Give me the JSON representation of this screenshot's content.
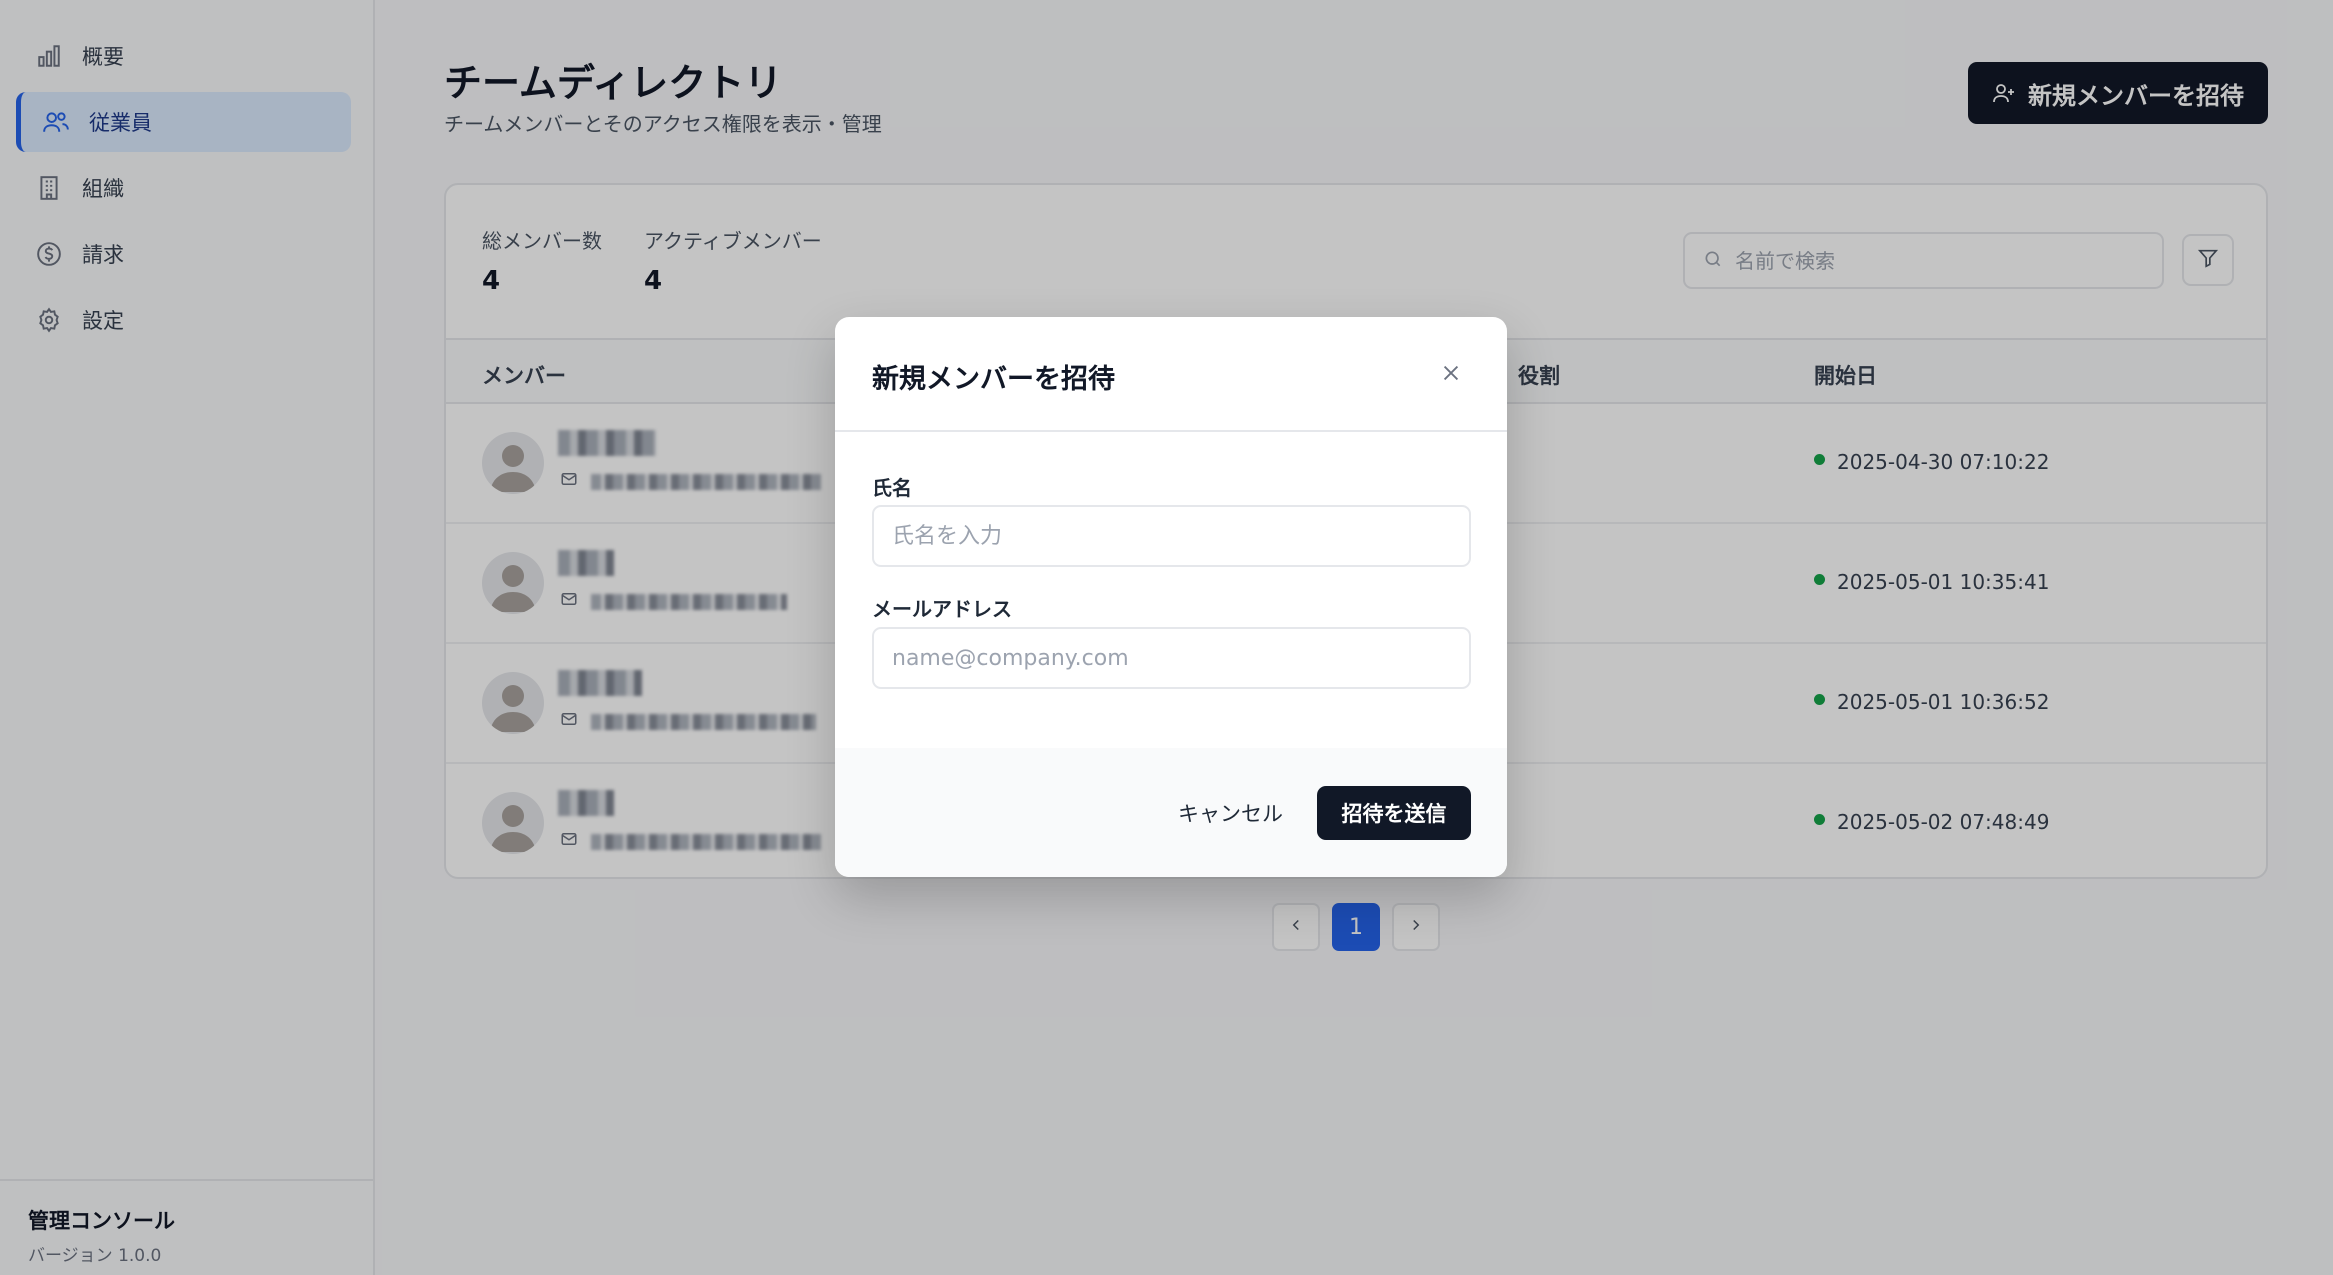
{
  "sidebar": {
    "items": [
      {
        "label": "概要",
        "icon": "bar-chart-icon"
      },
      {
        "label": "従業員",
        "icon": "users-icon",
        "active": true
      },
      {
        "label": "組織",
        "icon": "building-icon"
      },
      {
        "label": "請求",
        "icon": "dollar-icon"
      },
      {
        "label": "設定",
        "icon": "gear-icon"
      }
    ],
    "footer": {
      "title": "管理コンソール",
      "version": "バージョン 1.0.0"
    }
  },
  "header": {
    "title": "チームディレクトリ",
    "subtitle": "チームメンバーとそのアクセス権限を表示・管理",
    "invite_label": "新規メンバーを招待"
  },
  "stats": {
    "total_label": "総メンバー数",
    "total_value": "4",
    "active_label": "アクティブメンバー",
    "active_value": "4"
  },
  "search": {
    "placeholder": "名前で検索"
  },
  "table": {
    "columns": [
      "メンバー",
      "役割",
      "開始日"
    ],
    "rows": [
      {
        "start": "2025-04-30 07:10:22"
      },
      {
        "start": "2025-05-01 10:35:41"
      },
      {
        "start": "2025-05-01 10:36:52"
      },
      {
        "start": "2025-05-02 07:48:49"
      }
    ]
  },
  "pagination": {
    "current": "1"
  },
  "modal": {
    "title": "新規メンバーを招待",
    "name_label": "氏名",
    "name_placeholder": "氏名を入力",
    "email_label": "メールアドレス",
    "email_placeholder": "name@company.com",
    "cancel_label": "キャンセル",
    "send_label": "招待を送信"
  },
  "colors": {
    "primary": "#111827",
    "accent": "#2563eb",
    "active_status": "#16a34a"
  }
}
